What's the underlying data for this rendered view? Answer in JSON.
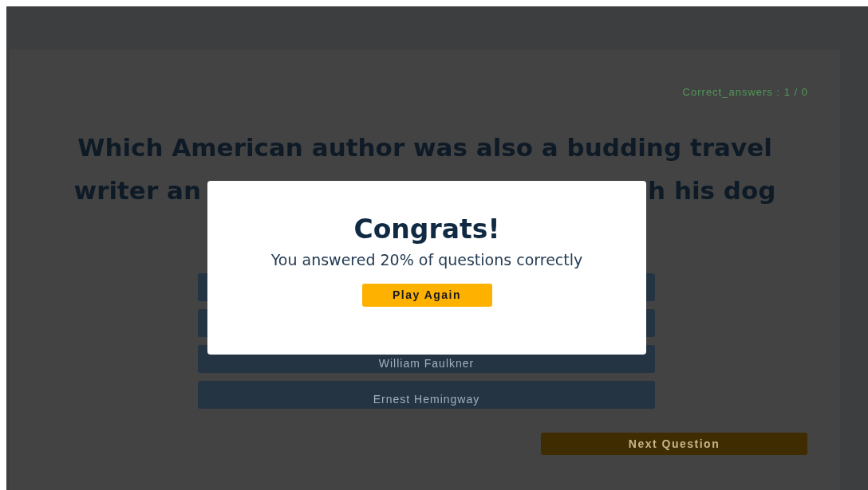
{
  "score": {
    "text": "Correct_answers : 1 / 0"
  },
  "question": {
    "line_1": "Which American author was also a budding travel",
    "line_2_left": "writer an",
    "line_2_right": "h his dog"
  },
  "answers": [
    {
      "kind": "covered"
    },
    {
      "kind": "covered"
    },
    {
      "kind": "option",
      "label": "William Faulkner"
    },
    {
      "kind": "option",
      "label": "Ernest Hemingway"
    }
  ],
  "next_button": "Next Question",
  "modal": {
    "title": "Congrats!",
    "message": "You answered 20% of questions correctly",
    "button": "Play Again"
  }
}
